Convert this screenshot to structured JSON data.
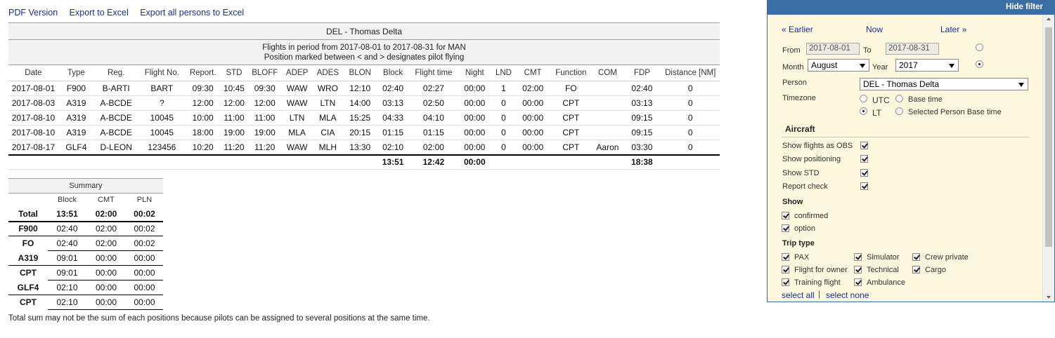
{
  "links": {
    "pdf": "PDF Version",
    "excel": "Export to Excel",
    "excel_all": "Export all persons to Excel"
  },
  "report": {
    "title": "DEL - Thomas Delta",
    "period_line1": "Flights in period from 2017-08-01 to 2017-08-31 for MAN",
    "period_line2": "Position marked between < and > designates pilot flying"
  },
  "columns": [
    "Date",
    "Type",
    "Reg.",
    "Flight No.",
    "Report.",
    "STD",
    "BLOFF",
    "ADEP",
    "ADES",
    "BLON",
    "Block",
    "Flight time",
    "Night",
    "LND",
    "CMT",
    "Function",
    "COM",
    "FDP",
    "Distance [NM]"
  ],
  "rows": [
    [
      "2017-08-01",
      "F900",
      "B-ARTI",
      "BART",
      "09:30",
      "10:45",
      "09:30",
      "WAW",
      "WRO",
      "12:10",
      "02:40",
      "02:27",
      "00:00",
      "1",
      "02:00",
      "FO",
      "",
      "02:40",
      "0"
    ],
    [
      "2017-08-03",
      "A319",
      "A-BCDE",
      "?",
      "12:00",
      "12:00",
      "12:00",
      "WAW",
      "LTN",
      "14:00",
      "03:13",
      "02:50",
      "00:00",
      "0",
      "00:00",
      "CPT",
      "",
      "03:13",
      "0"
    ],
    [
      "2017-08-10",
      "A319",
      "A-BCDE",
      "10045",
      "10:00",
      "11:00",
      "11:00",
      "LTN",
      "MLA",
      "15:25",
      "04:33",
      "04:10",
      "00:00",
      "0",
      "00:00",
      "CPT",
      "",
      "09:15",
      "0"
    ],
    [
      "2017-08-10",
      "A319",
      "A-BCDE",
      "10045",
      "18:00",
      "19:00",
      "19:00",
      "MLA",
      "CIA",
      "20:15",
      "01:15",
      "01:15",
      "00:00",
      "0",
      "00:00",
      "CPT",
      "",
      "09:15",
      "0"
    ],
    [
      "2017-08-17",
      "GLF4",
      "D-LEON",
      "123456",
      "10:20",
      "11:20",
      "11:20",
      "WAW",
      "MLH",
      "13:30",
      "02:10",
      "02:00",
      "00:00",
      "0",
      "00:00",
      "CPT",
      "Aaron",
      "03:30",
      "0"
    ]
  ],
  "totals": [
    "",
    "",
    "",
    "",
    "",
    "",
    "",
    "",
    "",
    "",
    "13:51",
    "12:42",
    "00:00",
    "",
    "",
    "",
    "",
    "18:38",
    ""
  ],
  "summary": {
    "title": "Summary",
    "headers": [
      "",
      "Block",
      "CMT",
      "PLN"
    ],
    "rows": [
      {
        "kind": "total",
        "cells": [
          "Total",
          "13:51",
          "02:00",
          "00:02"
        ]
      },
      {
        "kind": "group",
        "cells": [
          "F900",
          "02:40",
          "02:00",
          "00:02"
        ]
      },
      {
        "kind": "sub",
        "cells": [
          "FO",
          "02:40",
          "02:00",
          "00:02"
        ]
      },
      {
        "kind": "group",
        "cells": [
          "A319",
          "09:01",
          "00:00",
          "00:00"
        ]
      },
      {
        "kind": "sub",
        "cells": [
          "CPT",
          "09:01",
          "00:00",
          "00:00"
        ]
      },
      {
        "kind": "group",
        "cells": [
          "GLF4",
          "02:10",
          "00:00",
          "00:00"
        ]
      },
      {
        "kind": "sub",
        "cells": [
          "CPT",
          "02:10",
          "00:00",
          "00:00"
        ]
      }
    ]
  },
  "note": "Total sum may not be the sum of each positions because pilots can be assigned to several positions at the same time.",
  "filter": {
    "hide_label": "Hide filter",
    "earlier": "« Earlier",
    "now": "Now",
    "later": "Later »",
    "from_label": "From",
    "from_value": "2017-08-01",
    "to_label": "To",
    "to_value": "2017-08-31",
    "month_label": "Month",
    "month_value": "August",
    "year_label": "Year",
    "year_value": "2017",
    "person_label": "Person",
    "person_value": "DEL - Thomas Delta",
    "timezone_label": "Timezone",
    "tz_utc": "UTC",
    "tz_base": "Base time",
    "tz_lt": "LT",
    "tz_selected": "Selected Person Base time",
    "aircraft_title": "Aircraft",
    "aircraft_opts": [
      "Show flights as OBS",
      "Show positioning",
      "Show STD",
      "Report check"
    ],
    "show_title": "Show",
    "show_opts": [
      "confirmed",
      "option"
    ],
    "trip_title": "Trip type",
    "trip_col1": [
      "PAX",
      "Flight for owner",
      "Training flight"
    ],
    "trip_col2": [
      "Simulator",
      "Technical",
      "Ambulance"
    ],
    "trip_col3": [
      "Crew private",
      "Cargo"
    ],
    "select_all": "select all",
    "separator": "|",
    "select_none": "select none"
  }
}
